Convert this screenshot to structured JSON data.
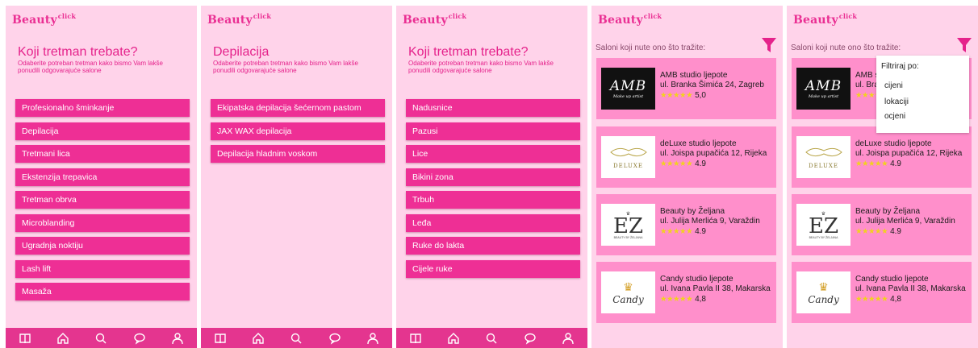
{
  "app": {
    "logo": "Beauty",
    "logo_sup": "click"
  },
  "screen1": {
    "title": "Koji tretman trebate?",
    "subtitle": "Odaberite potreban tretman kako bismo Vam lakše ponudili odgovarajuće salone",
    "items": [
      "Profesionalno šminkanje",
      "Depilacija",
      "Tretmani lica",
      "Ekstenzija trepavica",
      "Tretman obrva",
      "Microblanding",
      "Ugradnja noktiju",
      "Lash lift",
      "Masaža"
    ]
  },
  "screen2": {
    "title": "Depilacija",
    "subtitle": "Odaberite potreban tretman kako bismo Vam lakše ponudili odgovarajuće salone",
    "items": [
      "Ekipatska depilacija šećernom pastom",
      "JAX WAX depilacija",
      "Depilacija hladnim voskom"
    ]
  },
  "screen3": {
    "title": "Koji tretman trebate?",
    "subtitle": "Odaberite potreban tretman kako bismo Vam lakše ponudili odgovarajuće salone",
    "items": [
      "Nadusnice",
      "Pazusi",
      "Lice",
      "Bikini zona",
      "Trbuh",
      "Leđa",
      "Ruke do lakta",
      "Cijele ruke"
    ]
  },
  "salons_header": "Saloni koji nute ono što tražite:",
  "salons": [
    {
      "name": "AMB studio ljepote",
      "address": "ul. Branka Šimića 24, Zagreb",
      "rating": "5,0",
      "stars": 5,
      "logo_text": "AMB",
      "logo_sub": "Make up artist"
    },
    {
      "name": "deLuxe studio ljepote",
      "address": "ul. Joispa pupačića 12, Rijeka",
      "rating": "4.9",
      "stars": 5,
      "logo_text": "DELUXE",
      "logo_sub": ""
    },
    {
      "name": "Beauty by Željana",
      "address": "ul. Julija Merlića 9, Varaždin",
      "rating": "4.9",
      "stars": 5,
      "logo_text": "EZ",
      "logo_sub": "BEAUTY BY ŽELJANA"
    },
    {
      "name": "Candy studio ljepote",
      "address": "ul. Ivana Pavla II 38, Makarska",
      "rating": "4,8",
      "stars": 5,
      "logo_text": "Candy",
      "logo_sub": ""
    }
  ],
  "filter_menu": {
    "header": "Filtriraj po:",
    "options": [
      "cijeni",
      "lokaciji",
      "ocjeni"
    ]
  },
  "nav_icons": [
    "book-icon",
    "home-icon",
    "search-icon",
    "chat-icon",
    "profile-icon"
  ],
  "colors": {
    "accent": "#ee2f95",
    "background": "#ffd3ea",
    "card": "#ff8fcb",
    "nav": "#e4358f",
    "star": "#f2d21c"
  }
}
